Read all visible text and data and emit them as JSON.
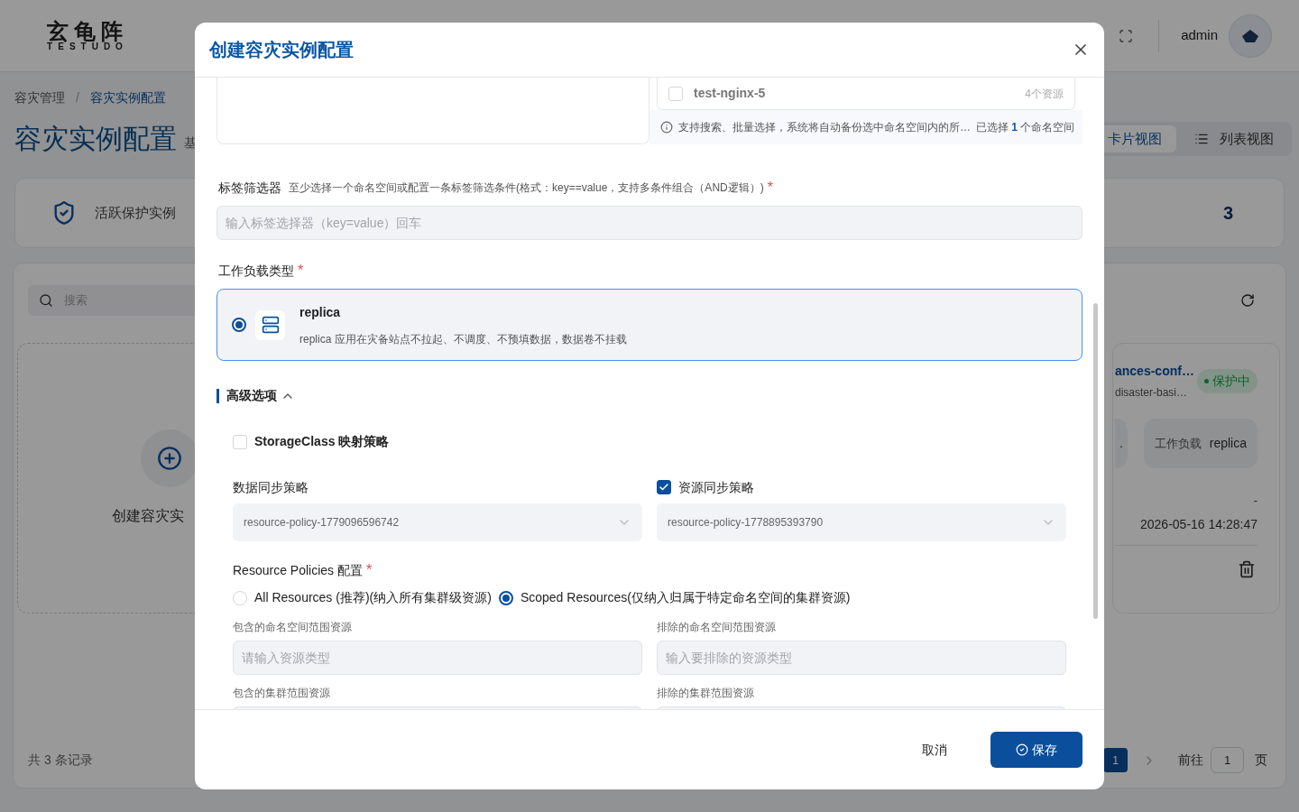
{
  "app": {
    "logo": "玄龟阵",
    "logo_sub": "TESTUDO",
    "user": "admin"
  },
  "breadcrumb": {
    "separator": "/",
    "items": [
      {
        "label": "容灾管理",
        "selected": false
      },
      {
        "label": "容灾实例配置",
        "selected": true
      }
    ]
  },
  "page": {
    "title": "容灾实例配置",
    "subtitle": "基"
  },
  "stats": {
    "label": "活跃保护实例",
    "value": "3"
  },
  "view_toggle": [
    {
      "label": "卡片视图",
      "selected": true
    },
    {
      "label": "列表视图",
      "selected": false
    }
  ],
  "search": {
    "placeholder": "搜索"
  },
  "create_card": {
    "label": "创建容灾实"
  },
  "instance_card": {
    "name": "ances-conf…",
    "subtitle": "disaster-basi…",
    "status": "保护中",
    "field_1": ".",
    "workload_label": "工作负载",
    "workload": "replica",
    "field_2": "-",
    "time": "2026-05-16 14:28:47"
  },
  "pagination": {
    "total": "共 3 条记录",
    "pages": [
      {
        "label": "1",
        "selected": true
      }
    ],
    "goto_label": "前往",
    "goto_value": "1",
    "page_unit": "页"
  },
  "dialog": {
    "title": "创建容灾实例配置",
    "namespaces": {
      "rows": [
        {
          "name": "test-nginx-5",
          "count": "4个资源",
          "checked": false
        }
      ],
      "hint": "支持搜索、批量选择，系统将自动备份选中命名空间内的所…",
      "selected_prefix": "已选择",
      "selected_count": "1",
      "selected_suffix": "个命名空间"
    },
    "label_selector": {
      "label": "标签筛选器",
      "hint": "至少选择一个命名空间或配置一条标签筛选条件(格式：key==value，支持多条件组合（AND逻辑）)",
      "required_mark": "*",
      "placeholder": "输入标签选择器（key=value）回车"
    },
    "workload_type": {
      "label": "工作负载类型",
      "required_mark": "*",
      "options": [
        {
          "title": "replica",
          "description": "replica 应用在灾备站点不拉起、不调度、不预填数据，数据卷不挂载",
          "selected": true
        }
      ]
    },
    "advanced": {
      "title": "高级选项",
      "expanded": true,
      "storage_class": {
        "label": "StorageClass 映射策略",
        "checked": false
      },
      "data_sync": {
        "label": "数据同步策略",
        "value": "resource-policy-1779096596742"
      },
      "resource_sync": {
        "label": "资源同步策略",
        "checked": true,
        "value": "resource-policy-1778895393790"
      },
      "resource_policies": {
        "label": "Resource Policies 配置",
        "required_mark": "*",
        "options": [
          {
            "label": "All Resources (推荐)(纳入所有集群级资源)",
            "selected": false
          },
          {
            "label": "Scoped Resources(仅纳入归属于特定命名空间的集群资源)",
            "selected": true
          }
        ]
      },
      "fields": [
        {
          "label": "包含的命名空间范围资源",
          "placeholder": "请输入资源类型"
        },
        {
          "label": "排除的命名空间范围资源",
          "placeholder": "输入要排除的资源类型"
        },
        {
          "label": "包含的集群范围资源"
        },
        {
          "label": "排除的集群范围资源"
        }
      ]
    },
    "buttons": {
      "cancel": "取消",
      "save": "保存"
    }
  }
}
